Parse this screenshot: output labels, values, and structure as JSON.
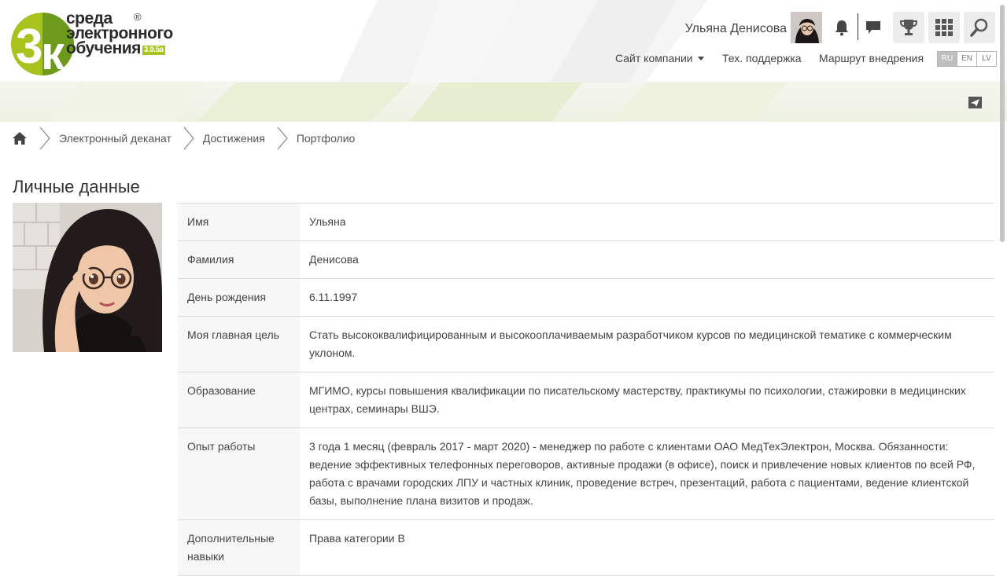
{
  "header": {
    "logo": {
      "line1": "среда",
      "line2": "электронного",
      "line3": "обучения",
      "version": "3.9.5a",
      "reg_mark": "®"
    },
    "user_name": "Ульяна Денисова",
    "icons": [
      "bell-icon",
      "chat-icon",
      "trophy-icon",
      "apps-grid-icon",
      "search-icon",
      "send-icon",
      "home-icon"
    ],
    "nav": {
      "company_site": "Сайт компании",
      "support": "Тех. поддержка",
      "roadmap": "Маршрут внедрения"
    },
    "languages": [
      "RU",
      "EN",
      "LV"
    ],
    "active_language": "RU"
  },
  "breadcrumb": {
    "items": [
      "Электронный деканат",
      "Достижения",
      "Портфолио"
    ]
  },
  "page": {
    "title": "Личные данные"
  },
  "profile": {
    "rows": [
      {
        "label": "Имя",
        "value": "Ульяна"
      },
      {
        "label": "Фамилия",
        "value": "Денисова"
      },
      {
        "label": "День рождения",
        "value": "6.11.1997"
      },
      {
        "label": "Моя главная цель",
        "value": "Стать высококвалифицированным и высокооплачиваемым разработчиком курсов по медицинской тематике с коммерческим уклоном."
      },
      {
        "label": "Образование",
        "value": "МГИМО, курсы повышения квалификации по писательскому мастерству, практикумы по психологии, стажировки в медицинских центрах, семинары ВШЭ."
      },
      {
        "label": "Опыт работы",
        "value": "3 года 1 месяц (февраль 2017 - март 2020) - менеджер по работе с клиентами ОАО МедТехЭлектрон, Москва. Обязанности: ведение эффективных телефонных переговоров, активные продажи (в офисе), поиск и привлечение новых клиентов по всей РФ, работа с врачами городских ЛПУ и частных клиник, проведение встреч, презентаций, работа с пациентами, ведение клиентской базы, выполнение плана визитов и продаж."
      },
      {
        "label": "Дополнительные навыки",
        "value": "Права категории В"
      }
    ]
  },
  "colors": {
    "brand_green": "#a9c21d",
    "brand_dark_green": "#6e9a1c"
  }
}
